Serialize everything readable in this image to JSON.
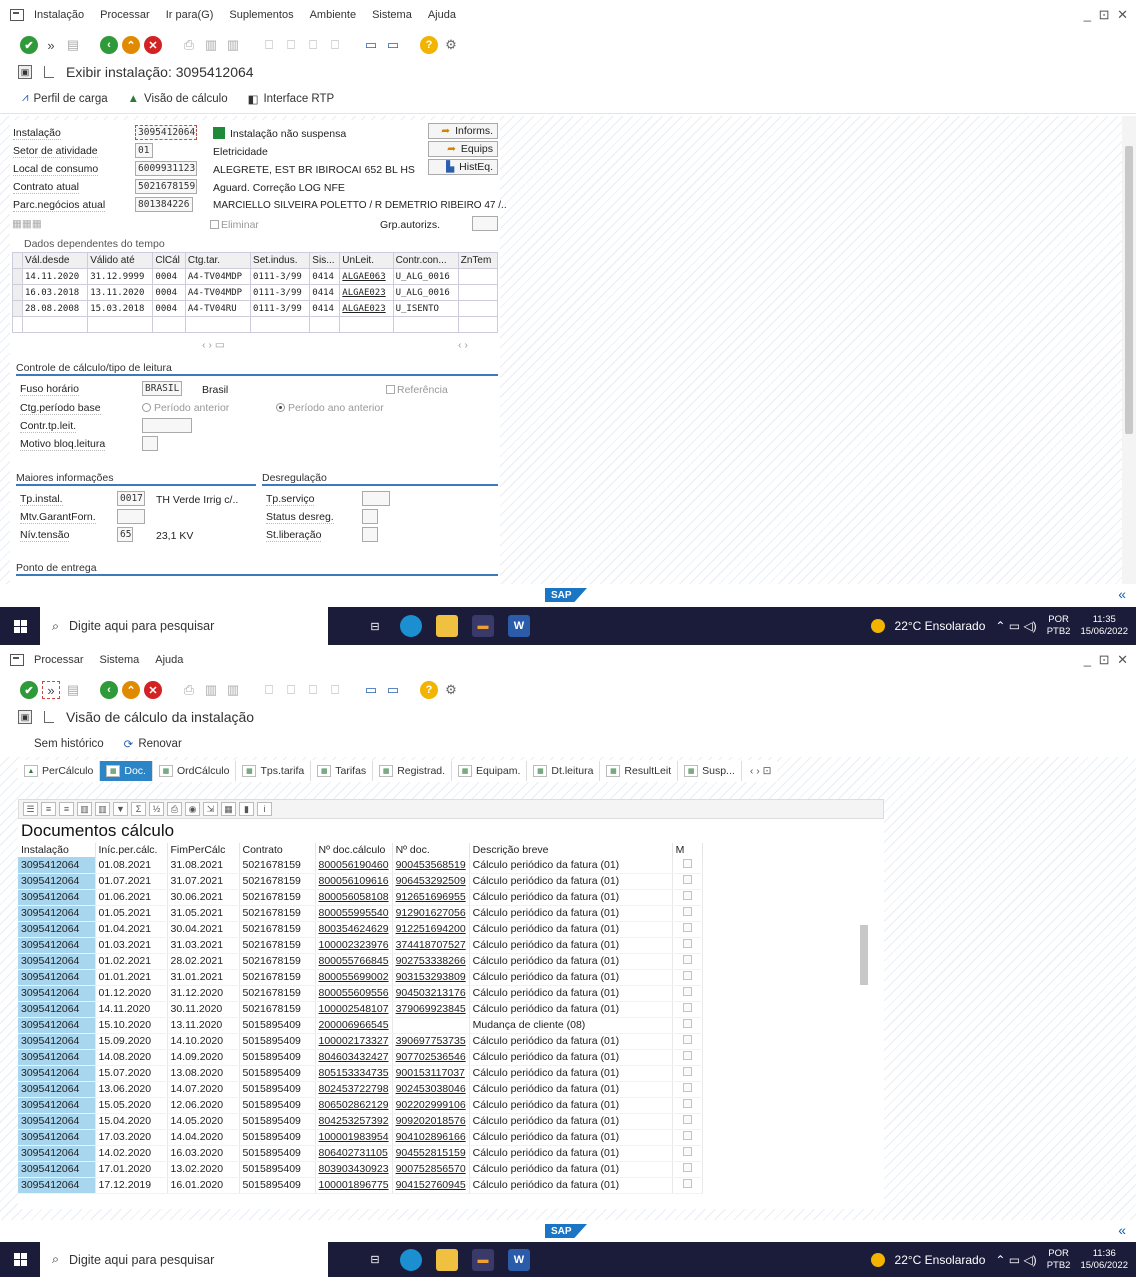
{
  "window1": {
    "menu": [
      "Instalação",
      "Processar",
      "Ir para(G)",
      "Suplementos",
      "Ambiente",
      "Sistema",
      "Ajuda"
    ],
    "window_controls": "_ ⊡ ✕",
    "title": "Exibir instalação: 3095412064",
    "app_toolbar": [
      "Perfil de carga",
      "Visão de cálculo",
      "Interface RTP"
    ],
    "fields": {
      "instalacao": {
        "label": "Instalação",
        "value": "3095412064",
        "status": "Instalação não suspensa"
      },
      "setor": {
        "label": "Setor de atividade",
        "value": "01",
        "text": "Eletricidade"
      },
      "local": {
        "label": "Local de consumo",
        "value": "6009931123",
        "text": "ALEGRETE, EST BR IBIROCAI 652 BL HS"
      },
      "contrato": {
        "label": "Contrato atual",
        "value": "5021678159",
        "text": "Aguard. Correção LOG NFE"
      },
      "parc": {
        "label": "Parc.negócios atual",
        "value": "801384226",
        "text": "MARCIELLO SILVEIRA POLETTO / R DEMETRIO RIBEIRO 47 /.."
      },
      "eliminar": "Eliminar",
      "grp": "Grp.autorizs."
    },
    "side_buttons": [
      "Informs.",
      "Equips",
      "HistEq."
    ],
    "time_dep": {
      "title": "Dados dependentes do tempo",
      "headers": [
        "Vál.desde",
        "Válido até",
        "ClCál",
        "Ctg.tar.",
        "Set.indus.",
        "Sis...",
        "UnLeit.",
        "Contr.con...",
        "ZnTem"
      ],
      "rows": [
        [
          "14.11.2020",
          "31.12.9999",
          "0004",
          "A4-TV04MDP",
          "0111-3/99",
          "0414",
          "ALGAE063",
          "U_ALG_0016"
        ],
        [
          "16.03.2018",
          "13.11.2020",
          "0004",
          "A4-TV04MDP",
          "0111-3/99",
          "0414",
          "ALGAE023",
          "U_ALG_0016"
        ],
        [
          "28.08.2008",
          "15.03.2018",
          "0004",
          "A4-TV04RU",
          "0111-3/99",
          "0414",
          "ALGAE023",
          "U_ISENTO"
        ]
      ]
    },
    "controle": {
      "title": "Controle de cálculo/tipo de leitura",
      "fuso_label": "Fuso horário",
      "fuso_value": "BRASIL",
      "fuso_text": "Brasil",
      "referencia": "Referência",
      "ctg_label": "Ctg.período base",
      "opt1": "Período anterior",
      "opt2": "Período ano anterior",
      "contr_label": "Contr.tp.leit.",
      "motivo_label": "Motivo bloq.leitura"
    },
    "maiores": {
      "title": "Maiores informações",
      "tp_label": "Tp.instal.",
      "tp_value": "0017",
      "tp_text": "TH Verde Irrig c/..",
      "mtv_label": "Mtv.GarantForn.",
      "niv_label": "Nív.tensão",
      "niv_value": "65",
      "niv_text": "23,1 KV"
    },
    "desreg": {
      "title": "Desregulação",
      "labels": [
        "Tp.serviço",
        "Status desreg.",
        "St.liberação"
      ]
    },
    "ponto": "Ponto de entrega"
  },
  "window2": {
    "menu": [
      "Processar",
      "Sistema",
      "Ajuda"
    ],
    "title": "Visão de cálculo da instalação",
    "app_toolbar": [
      "Sem histórico",
      "Renovar"
    ],
    "tabs": [
      "PerCálculo",
      "Doc.",
      "OrdCálculo",
      "Tps.tarifa",
      "Tarifas",
      "Registrad.",
      "Equipam.",
      "Dt.leitura",
      "ResultLeit",
      "Susp..."
    ],
    "active_tab": "Doc.",
    "grid_title": "Documentos cálculo",
    "columns": [
      "Instalação",
      "Iníc.per.cálc.",
      "FimPerCálc",
      "Contrato",
      "Nº doc.cálculo",
      "Nº doc.",
      "Descrição breve",
      "M"
    ],
    "rows": [
      [
        "3095412064",
        "01.08.2021",
        "31.08.2021",
        "5021678159",
        "800056190460",
        "900453568519",
        "Cálculo periódico da fatura (01)"
      ],
      [
        "3095412064",
        "01.07.2021",
        "31.07.2021",
        "5021678159",
        "800056109616",
        "906453292509",
        "Cálculo periódico da fatura (01)"
      ],
      [
        "3095412064",
        "01.06.2021",
        "30.06.2021",
        "5021678159",
        "800056058108",
        "912651696955",
        "Cálculo periódico da fatura (01)"
      ],
      [
        "3095412064",
        "01.05.2021",
        "31.05.2021",
        "5021678159",
        "800055995540",
        "912901627056",
        "Cálculo periódico da fatura (01)"
      ],
      [
        "3095412064",
        "01.04.2021",
        "30.04.2021",
        "5021678159",
        "800354624629",
        "912251694200",
        "Cálculo periódico da fatura (01)"
      ],
      [
        "3095412064",
        "01.03.2021",
        "31.03.2021",
        "5021678159",
        "100002323976",
        "374418707527",
        "Cálculo periódico da fatura (01)"
      ],
      [
        "3095412064",
        "01.02.2021",
        "28.02.2021",
        "5021678159",
        "800055766845",
        "902753338266",
        "Cálculo periódico da fatura (01)"
      ],
      [
        "3095412064",
        "01.01.2021",
        "31.01.2021",
        "5021678159",
        "800055699002",
        "903153293809",
        "Cálculo periódico da fatura (01)"
      ],
      [
        "3095412064",
        "01.12.2020",
        "31.12.2020",
        "5021678159",
        "800055609556",
        "904503213176",
        "Cálculo periódico da fatura (01)"
      ],
      [
        "3095412064",
        "14.11.2020",
        "30.11.2020",
        "5021678159",
        "100002548107",
        "379069923845",
        "Cálculo periódico da fatura (01)"
      ],
      [
        "3095412064",
        "15.10.2020",
        "13.11.2020",
        "5015895409",
        "200006966545",
        "",
        "Mudança de cliente (08)"
      ],
      [
        "3095412064",
        "15.09.2020",
        "14.10.2020",
        "5015895409",
        "100002173327",
        "390697753735",
        "Cálculo periódico da fatura (01)"
      ],
      [
        "3095412064",
        "14.08.2020",
        "14.09.2020",
        "5015895409",
        "804603432427",
        "907702536546",
        "Cálculo periódico da fatura (01)"
      ],
      [
        "3095412064",
        "15.07.2020",
        "13.08.2020",
        "5015895409",
        "805153334735",
        "900153117037",
        "Cálculo periódico da fatura (01)"
      ],
      [
        "3095412064",
        "13.06.2020",
        "14.07.2020",
        "5015895409",
        "802453722798",
        "902453038046",
        "Cálculo periódico da fatura (01)"
      ],
      [
        "3095412064",
        "15.05.2020",
        "12.06.2020",
        "5015895409",
        "806502862129",
        "902202999106",
        "Cálculo periódico da fatura (01)"
      ],
      [
        "3095412064",
        "15.04.2020",
        "14.05.2020",
        "5015895409",
        "804253257392",
        "909202018576",
        "Cálculo periódico da fatura (01)"
      ],
      [
        "3095412064",
        "17.03.2020",
        "14.04.2020",
        "5015895409",
        "100001983954",
        "904102896166",
        "Cálculo periódico da fatura (01)"
      ],
      [
        "3095412064",
        "14.02.2020",
        "16.03.2020",
        "5015895409",
        "806402731105",
        "904552815159",
        "Cálculo periódico da fatura (01)"
      ],
      [
        "3095412064",
        "17.01.2020",
        "13.02.2020",
        "5015895409",
        "803903430923",
        "900752856570",
        "Cálculo periódico da fatura (01)"
      ],
      [
        "3095412064",
        "17.12.2019",
        "16.01.2020",
        "5015895409",
        "100001896775",
        "904152760945",
        "Cálculo periódico da fatura (01)"
      ]
    ]
  },
  "taskbar": {
    "search_placeholder": "Digite aqui para pesquisar",
    "weather": "22°C Ensolarado",
    "lang": "POR",
    "layout": "PTB2",
    "clock1_time": "11:35",
    "clock2_time": "11:36",
    "date": "15/06/2022"
  },
  "sap_logo": "SAP"
}
